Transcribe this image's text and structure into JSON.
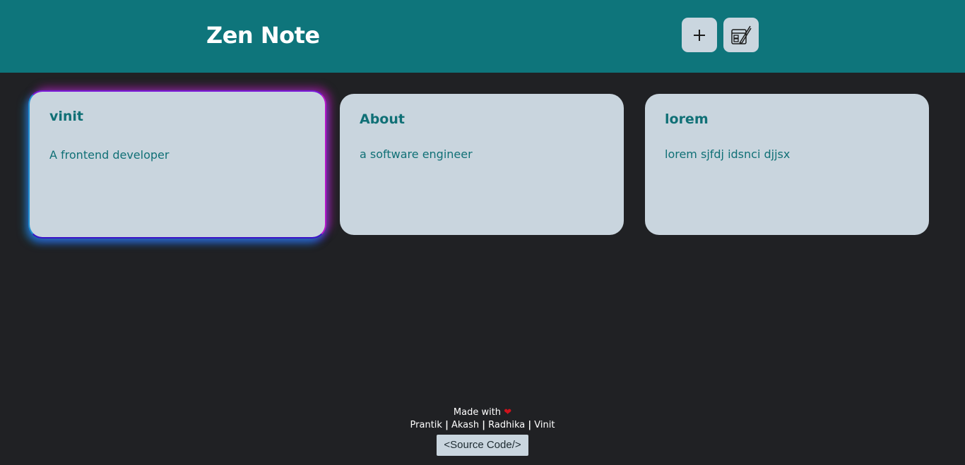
{
  "header": {
    "title": "Zen Note",
    "add_icon": "plus-icon",
    "edit_icon": "notepad-edit-icon"
  },
  "notes": [
    {
      "title": "vinit",
      "body": "A frontend developer"
    },
    {
      "title": "About",
      "body": "a software engineer"
    },
    {
      "title": "lorem",
      "body": "lorem sjfdj idsnci djjsx"
    }
  ],
  "footer": {
    "made_with": "Made with",
    "heart_icon": "heart-icon",
    "credits": [
      "Prantik",
      "Akash",
      "Radhika",
      "Vinit"
    ],
    "separator": "|",
    "source_code_label": "<Source Code/>"
  },
  "colors": {
    "header_bg": "#0e757b",
    "page_bg": "#202124",
    "card_bg": "#c9d5de",
    "accent_text": "#107076",
    "heart": "#d0121b"
  }
}
